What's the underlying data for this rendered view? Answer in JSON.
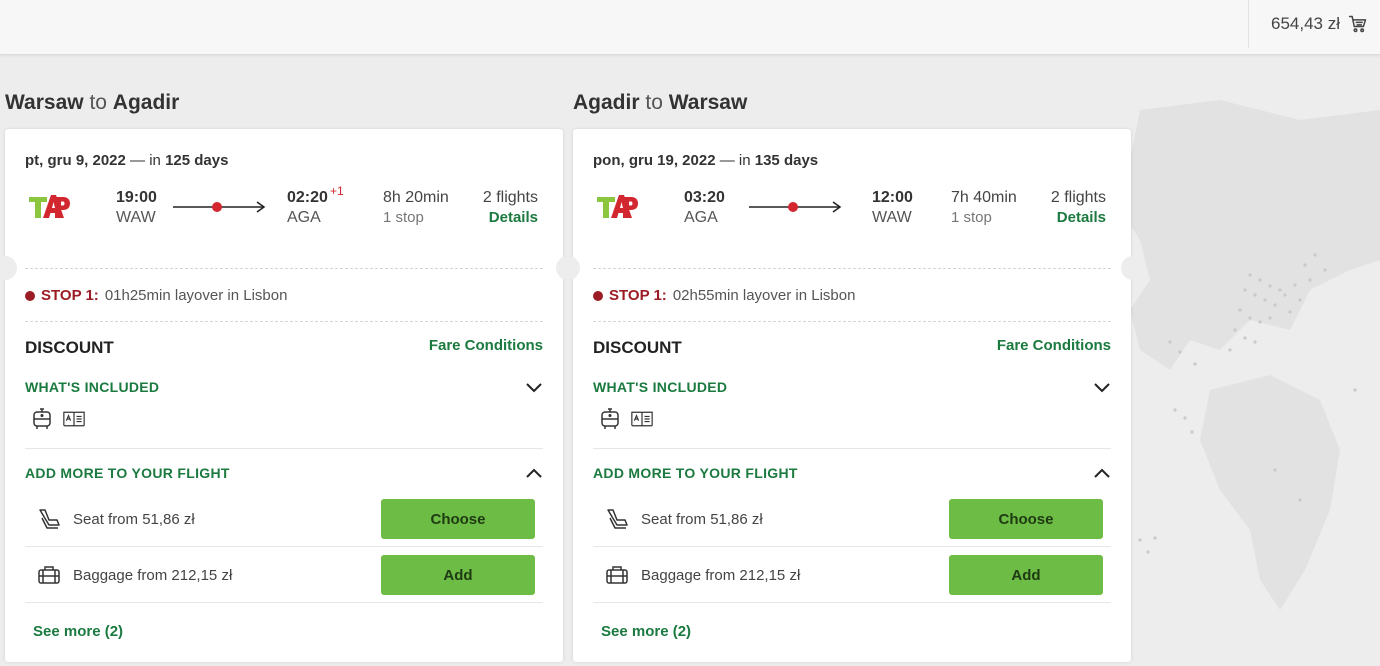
{
  "cart": {
    "total": "654,43 zł",
    "icon": "cart-icon"
  },
  "trips": [
    {
      "from": "Warsaw",
      "connector": "to",
      "to": "Agadir",
      "date": "pt, gru 9, 2022",
      "date_sep": "—",
      "in_label": "in",
      "days": "125 days",
      "airline_logo": "tap-logo",
      "depart_time": "19:00",
      "depart_code": "WAW",
      "arrive_time": "02:20",
      "arrive_plus": "+1",
      "arrive_code": "AGA",
      "duration": "8h 20min",
      "stops": "1 stop",
      "flights": "2 flights",
      "details": "Details",
      "stop_label": "STOP 1:",
      "stop_text": "01h25min layover in Lisbon",
      "fare_name": "DISCOUNT",
      "fare_conditions": "Fare Conditions",
      "included_title": "WHAT'S INCLUDED",
      "addmore_title": "ADD MORE TO YOUR FLIGHT",
      "seat_label": "Seat from 51,86 zł",
      "seat_button": "Choose",
      "baggage_label": "Baggage from 212,15 zł",
      "baggage_button": "Add",
      "see_more": "See more (2)"
    },
    {
      "from": "Agadir",
      "connector": "to",
      "to": "Warsaw",
      "date": "pon, gru 19, 2022",
      "date_sep": "—",
      "in_label": "in",
      "days": "135 days",
      "airline_logo": "tap-logo",
      "depart_time": "03:20",
      "depart_code": "AGA",
      "arrive_time": "12:00",
      "arrive_plus": "",
      "arrive_code": "WAW",
      "duration": "7h 40min",
      "stops": "1 stop",
      "flights": "2 flights",
      "details": "Details",
      "stop_label": "STOP 1:",
      "stop_text": "02h55min layover in Lisbon",
      "fare_name": "DISCOUNT",
      "fare_conditions": "Fare Conditions",
      "included_title": "WHAT'S INCLUDED",
      "addmore_title": "ADD MORE TO YOUR FLIGHT",
      "seat_label": "Seat from 51,86 zł",
      "seat_button": "Choose",
      "baggage_label": "Baggage from 212,15 zł",
      "baggage_button": "Add",
      "see_more": "See more (2)"
    }
  ],
  "colors": {
    "accent_green": "#1b7a3f",
    "button_green": "#6dbc45",
    "stop_red": "#9b1c24",
    "tap_red": "#d2272e",
    "tap_green": "#8cc63f"
  }
}
